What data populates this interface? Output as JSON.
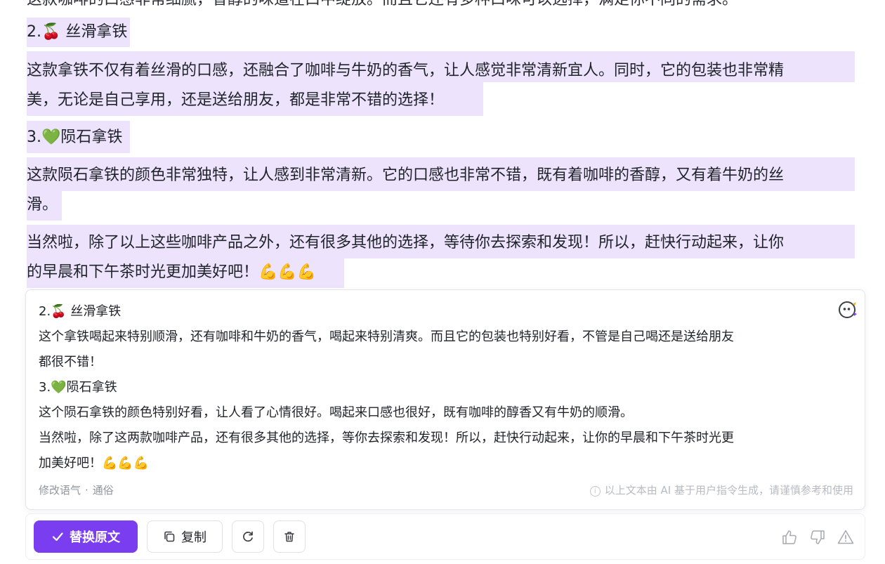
{
  "document": {
    "cut_line": "这款咖啡的口感非常细腻，香醇的味道在口中绽放。而且它还有多种口味可以选择，满足你不同的需求。",
    "item2_title": "2.🍒 丝滑拿铁",
    "item2_body_l1": "这款拿铁不仅有着丝滑的口感，还融合了咖啡与牛奶的香气，让人感觉非常清新宜人。同时，它的包装也非常精",
    "item2_body_l2": "美，无论是自己享用，还是送给朋友，都是非常不错的选择！",
    "item3_title": "3.💚陨石拿铁",
    "item3_body_l1": "这款陨石拿铁的颜色非常独特，让人感到非常清新。它的口感也非常不错，既有着咖啡的香醇，又有着牛奶的丝",
    "item3_body_l2": "滑。",
    "closing_l1": "当然啦，除了以上这些咖啡产品之外，还有很多其他的选择，等待你去探索和发现！所以，赶快行动起来，让你",
    "closing_l2": "的早晨和下午茶时光更加美好吧！💪💪💪"
  },
  "suggestion": {
    "line1": "2.🍒 丝滑拿铁",
    "line2": "这个拿铁喝起来特别顺滑，还有咖啡和牛奶的香气，喝起来特别清爽。而且它的包装也特别好看，不管是自己喝还是送给朋友",
    "line3": "都很不错！",
    "line4": "3.💚陨石拿铁",
    "line5": "这个陨石拿铁的颜色特别好看，让人看了心情很好。喝起来口感也很好，既有咖啡的醇香又有牛奶的顺滑。",
    "line6": "当然啦，除了这两款咖啡产品，还有很多其他的选择，等你去探索和发现！所以，赶快行动起来，让你的早晨和下午茶时光更",
    "line7": "加美好吧！💪💪💪",
    "mode_label": "修改语气",
    "mode_separator": "·",
    "mode_value": "通俗",
    "disclaimer": "以上文本由 AI 基于用户指令生成，请谨慎参考和使用"
  },
  "toolbar": {
    "replace_label": "替换原文",
    "copy_label": "复制"
  },
  "icons": {
    "assistant": "ai-assistant-icon",
    "check": "check-icon",
    "copy": "copy-icon",
    "regenerate": "refresh-icon",
    "delete": "trash-icon",
    "like": "thumbs-up-icon",
    "dislike": "thumbs-down-icon",
    "report": "warning-icon",
    "info": "info-icon"
  },
  "colors": {
    "accent": "#7a3ef0",
    "highlight": "#ede3fd",
    "muted_text": "#8f959e"
  }
}
